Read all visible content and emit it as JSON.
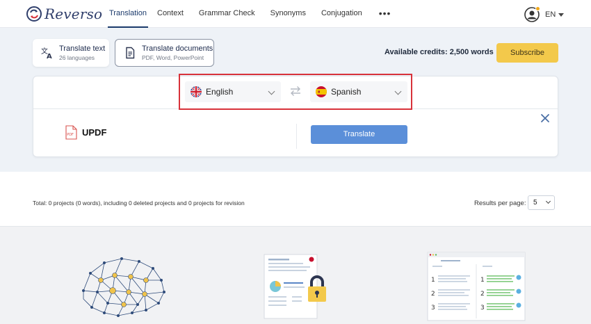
{
  "app": {
    "brand": "Reverso",
    "colors": {
      "accent": "#1b3a6b",
      "subscribe": "#f3c94b",
      "translate_button": "#5b8fd9",
      "highlight": "#d8323a"
    }
  },
  "nav": {
    "items": [
      {
        "label": "Translation",
        "active": true
      },
      {
        "label": "Context"
      },
      {
        "label": "Grammar Check"
      },
      {
        "label": "Synonyms"
      },
      {
        "label": "Conjugation"
      }
    ],
    "more": "•••"
  },
  "user": {
    "language": "EN",
    "icon": "user-avatar-icon"
  },
  "modes": {
    "text": {
      "title": "Translate text",
      "subtitle": "26 languages",
      "icon": "translate-icon"
    },
    "docs": {
      "title": "Translate documents",
      "subtitle": "PDF, Word, PowerPoint",
      "icon": "document-icon"
    }
  },
  "credits": "Available credits: 2,500 words",
  "subscribe_label": "Subscribe",
  "translator": {
    "source_language": "English",
    "target_language": "Spanish",
    "file_name": "UPDF",
    "translate_label": "Translate"
  },
  "projects": {
    "summary": "Total: 0 projects (0 words), including 0 deleted projects and 0 projects for revision",
    "results_label": "Results per page:",
    "results_value": "5"
  }
}
